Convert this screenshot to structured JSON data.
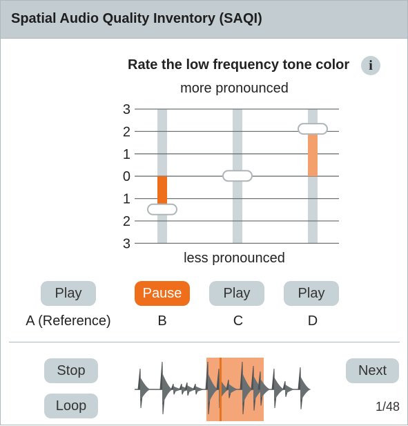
{
  "window": {
    "title": "Spatial Audio Quality Inventory (SAQI)"
  },
  "question": {
    "text": "Rate the low frequency tone color"
  },
  "info_button": {
    "label": "i"
  },
  "scale": {
    "top_label": "more pronounced",
    "bottom_label": "less pronounced",
    "tick_labels": [
      "3",
      "2",
      "1",
      "0",
      "1",
      "2",
      "3"
    ],
    "ticks": [
      3,
      2,
      1,
      0,
      -1,
      -2,
      -3
    ]
  },
  "sliders": [
    {
      "id": "B",
      "value": -1.5,
      "bar_color": "#ef6e1c"
    },
    {
      "id": "C",
      "value": 0,
      "bar_color": "#f4a06c"
    },
    {
      "id": "D",
      "value": 2.1,
      "bar_color": "#f4a06c"
    }
  ],
  "conditions": [
    {
      "button": "Play",
      "label": "A (Reference)"
    },
    {
      "button": "Pause",
      "label": "B",
      "active": true
    },
    {
      "button": "Play",
      "label": "C"
    },
    {
      "button": "Play",
      "label": "D"
    }
  ],
  "transport": {
    "stop": "Stop",
    "loop": "Loop",
    "next": "Next"
  },
  "progress": {
    "counter": "1/48"
  },
  "waveform": {
    "loop_region_color": "#f4a679",
    "playhead_color": "#e8741f"
  },
  "colors": {
    "accent": "#ef6e1c",
    "button": "#c6d2d5",
    "titlebar": "#c3ccd0"
  }
}
